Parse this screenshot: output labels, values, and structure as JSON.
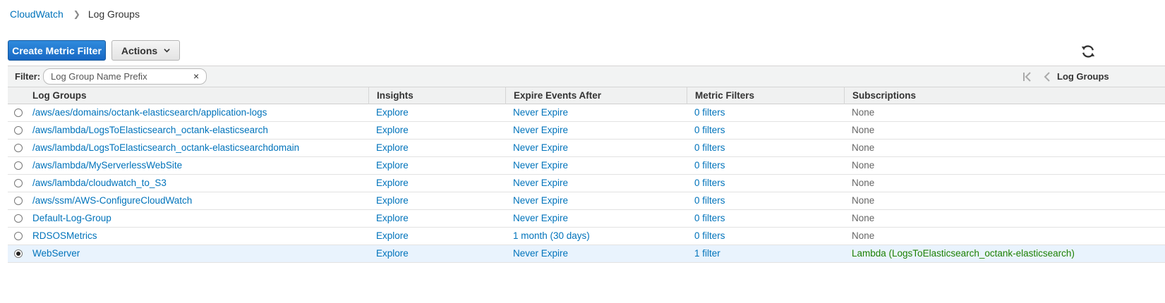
{
  "breadcrumb": {
    "root": "CloudWatch",
    "current": "Log Groups"
  },
  "toolbar": {
    "create_metric_filter": "Create Metric Filter",
    "actions": "Actions"
  },
  "filter": {
    "label": "Filter:",
    "placeholder": "Log Group Name Prefix",
    "clear": "×"
  },
  "pager": {
    "label": "Log Groups"
  },
  "table": {
    "headers": [
      "Log Groups",
      "Insights",
      "Expire Events After",
      "Metric Filters",
      "Subscriptions"
    ],
    "rows": [
      {
        "name": "/aws/aes/domains/octank-elasticsearch/application-logs",
        "insights": "Explore",
        "expire": "Never Expire",
        "filters": "0 filters",
        "subscriptions": "None",
        "selected": false
      },
      {
        "name": "/aws/lambda/LogsToElasticsearch_octank-elasticsearch",
        "insights": "Explore",
        "expire": "Never Expire",
        "filters": "0 filters",
        "subscriptions": "None",
        "selected": false
      },
      {
        "name": "/aws/lambda/LogsToElasticsearch_octank-elasticsearchdomain",
        "insights": "Explore",
        "expire": "Never Expire",
        "filters": "0 filters",
        "subscriptions": "None",
        "selected": false
      },
      {
        "name": "/aws/lambda/MyServerlessWebSite",
        "insights": "Explore",
        "expire": "Never Expire",
        "filters": "0 filters",
        "subscriptions": "None",
        "selected": false
      },
      {
        "name": "/aws/lambda/cloudwatch_to_S3",
        "insights": "Explore",
        "expire": "Never Expire",
        "filters": "0 filters",
        "subscriptions": "None",
        "selected": false
      },
      {
        "name": "/aws/ssm/AWS-ConfigureCloudWatch",
        "insights": "Explore",
        "expire": "Never Expire",
        "filters": "0 filters",
        "subscriptions": "None",
        "selected": false
      },
      {
        "name": "Default-Log-Group",
        "insights": "Explore",
        "expire": "Never Expire",
        "filters": "0 filters",
        "subscriptions": "None",
        "selected": false
      },
      {
        "name": "RDSOSMetrics",
        "insights": "Explore",
        "expire": "1 month (30 days)",
        "filters": "0 filters",
        "subscriptions": "None",
        "selected": false
      },
      {
        "name": "WebServer",
        "insights": "Explore",
        "expire": "Never Expire",
        "filters": "1 filter",
        "subscriptions": "Lambda (LogsToElasticsearch_octank-elasticsearch)",
        "selected": true
      }
    ]
  },
  "colors": {
    "link": "#0073bb",
    "primary": "#1868c4",
    "success": "#1d8102",
    "selected_row": "#e9f3fd"
  },
  "icons": {
    "breadcrumb_separator": "chevron-right-icon",
    "actions": "chevron-down-icon",
    "refresh": "refresh-icon",
    "pager_first": "first-page-icon",
    "pager_prev": "previous-page-icon",
    "clear": "close-icon"
  }
}
